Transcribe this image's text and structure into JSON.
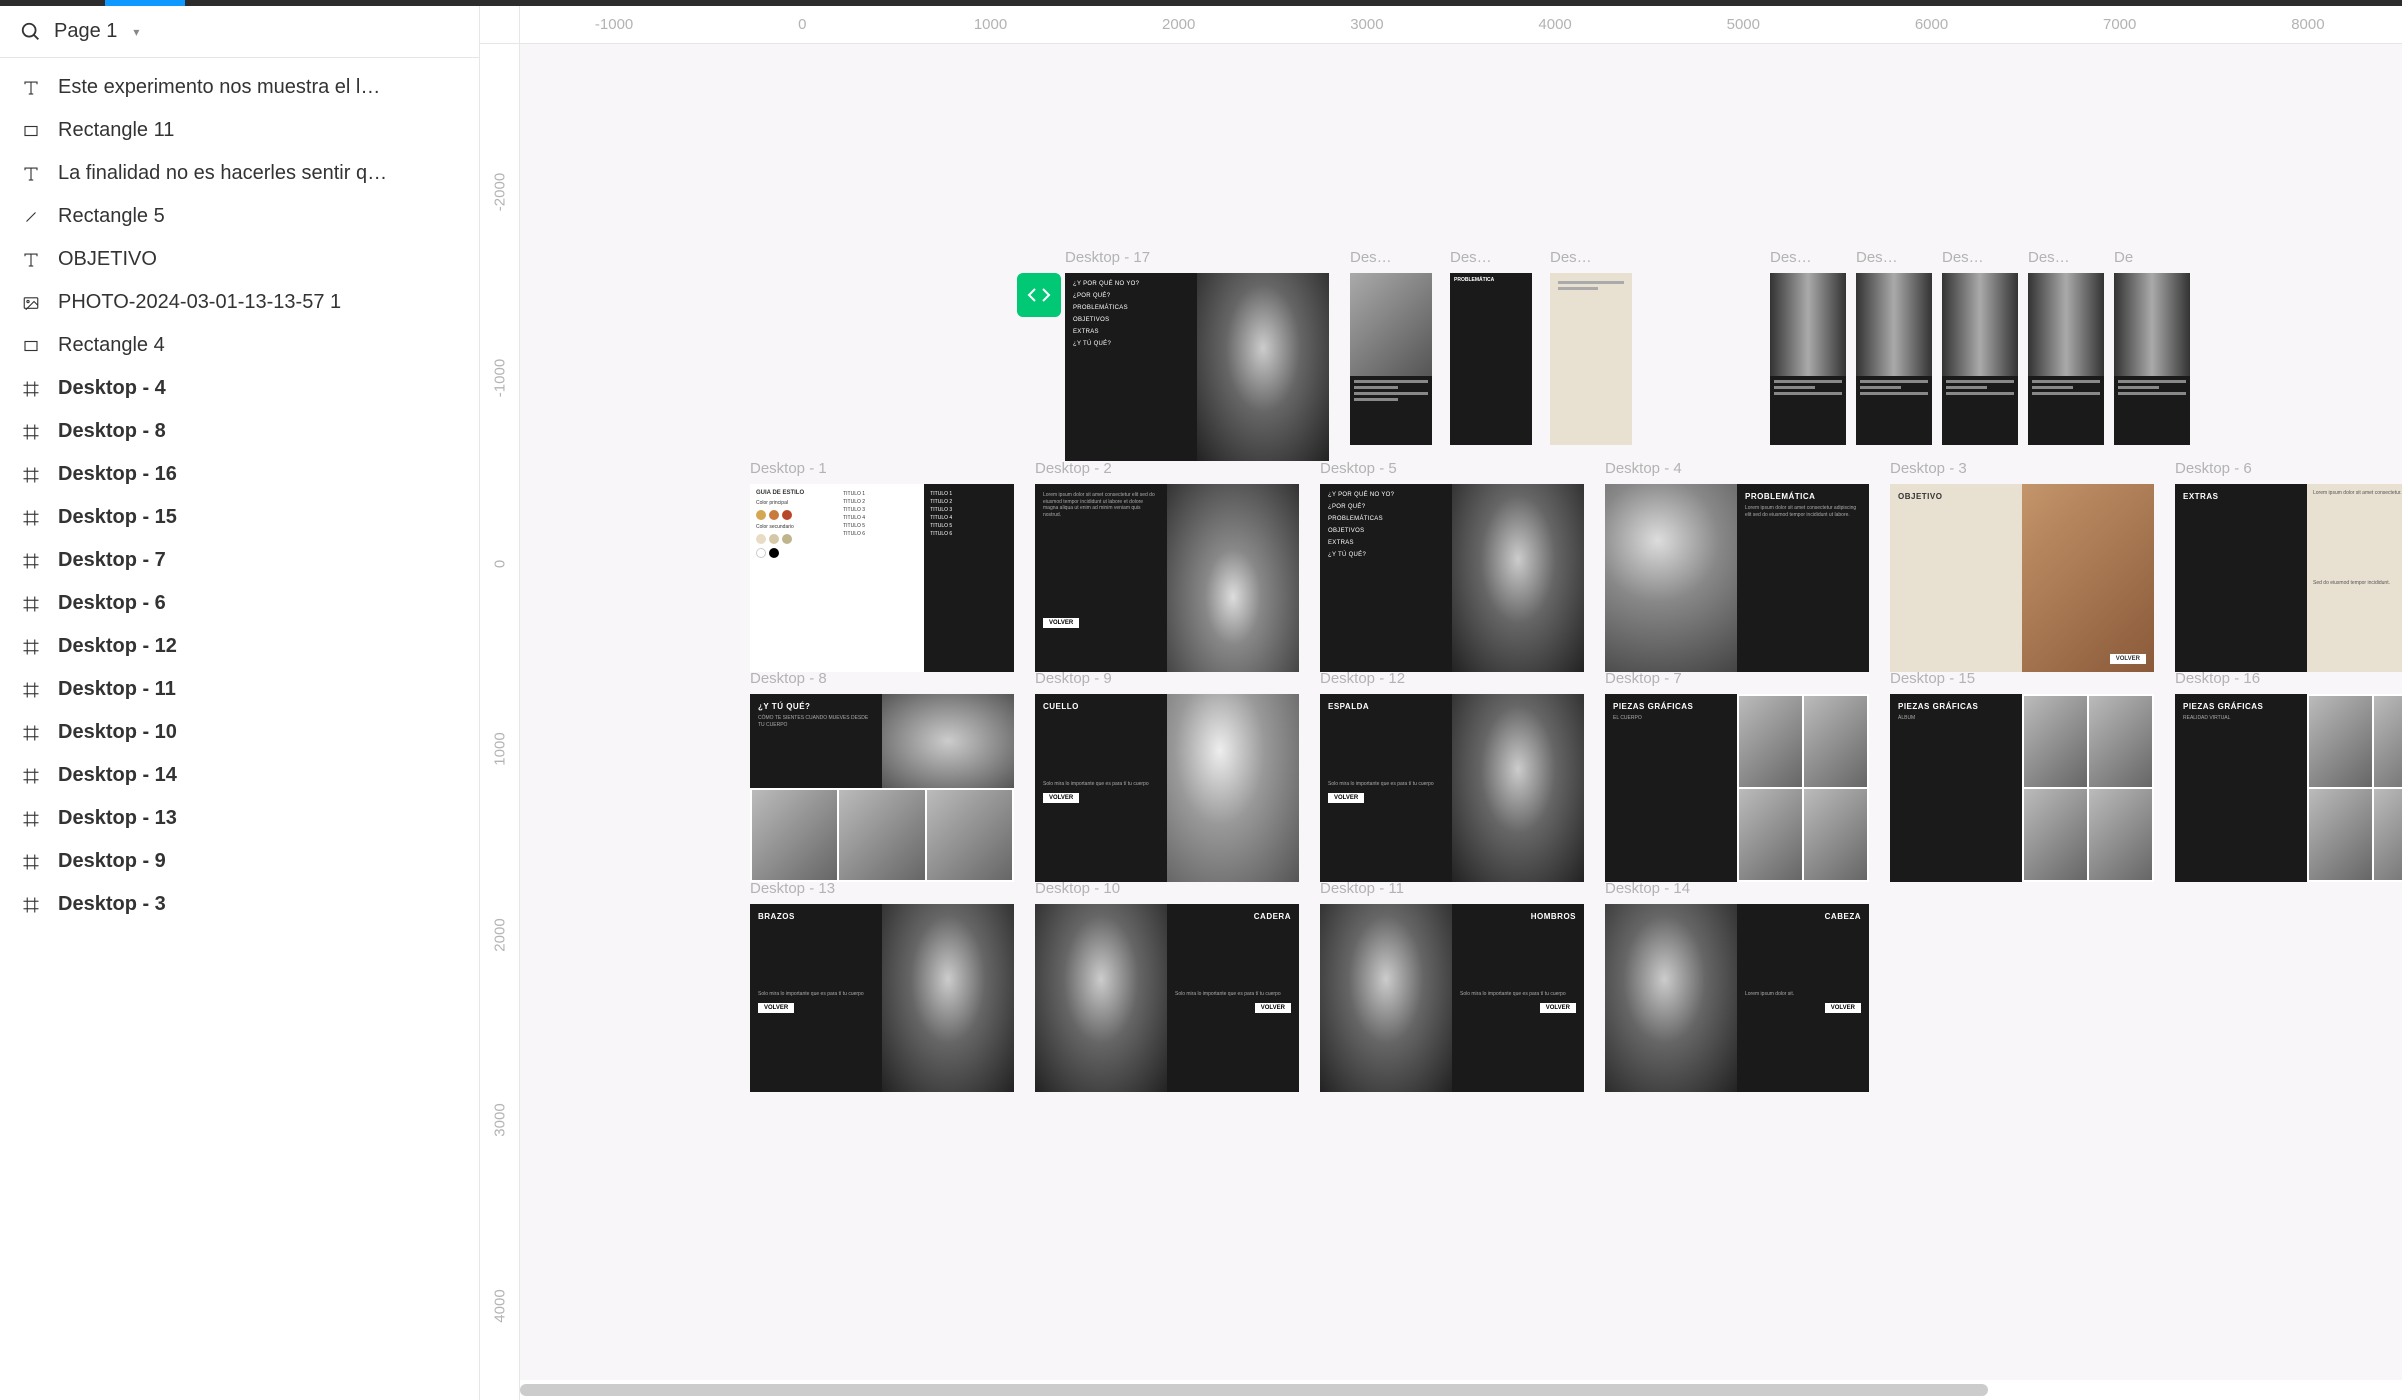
{
  "page": {
    "name": "Page 1"
  },
  "layers": [
    {
      "icon": "text",
      "label": "Este experimento nos muestra el l…",
      "bold": false
    },
    {
      "icon": "rect",
      "label": "Rectangle 11",
      "bold": false
    },
    {
      "icon": "text",
      "label": "La finalidad no es hacerles sentir q…",
      "bold": false
    },
    {
      "icon": "line",
      "label": "Rectangle 5",
      "bold": false
    },
    {
      "icon": "text",
      "label": "OBJETIVO",
      "bold": false
    },
    {
      "icon": "image",
      "label": "PHOTO-2024-03-01-13-13-57 1",
      "bold": false
    },
    {
      "icon": "rect",
      "label": "Rectangle 4",
      "bold": false
    },
    {
      "icon": "frame",
      "label": "Desktop - 4",
      "bold": true
    },
    {
      "icon": "frame",
      "label": "Desktop - 8",
      "bold": true
    },
    {
      "icon": "frame",
      "label": "Desktop - 16",
      "bold": true
    },
    {
      "icon": "frame",
      "label": "Desktop - 15",
      "bold": true
    },
    {
      "icon": "frame",
      "label": "Desktop - 7",
      "bold": true
    },
    {
      "icon": "frame",
      "label": "Desktop - 6",
      "bold": true
    },
    {
      "icon": "frame",
      "label": "Desktop - 12",
      "bold": true
    },
    {
      "icon": "frame",
      "label": "Desktop - 11",
      "bold": true
    },
    {
      "icon": "frame",
      "label": "Desktop - 10",
      "bold": true
    },
    {
      "icon": "frame",
      "label": "Desktop - 14",
      "bold": true
    },
    {
      "icon": "frame",
      "label": "Desktop - 13",
      "bold": true
    },
    {
      "icon": "frame",
      "label": "Desktop - 9",
      "bold": true
    },
    {
      "icon": "frame",
      "label": "Desktop - 3",
      "bold": true
    }
  ],
  "ruler_h": [
    "-1000",
    "0",
    "1000",
    "2000",
    "3000",
    "4000",
    "5000",
    "6000",
    "7000",
    "8000"
  ],
  "ruler_v": [
    "-2000",
    "-1000",
    "0",
    "1000",
    "2000",
    "3000",
    "4000"
  ],
  "frames": {
    "d17": {
      "label": "Desktop - 17",
      "menu": [
        "¿Y POR QUÉ NO YO?",
        "¿POR QUÉ?",
        "PROBLEMÁTICAS",
        "OBJETIVOS",
        "EXTRAS",
        "¿Y TÚ QUÉ?"
      ]
    },
    "top_small": [
      "Des…",
      "Des…",
      "Des…",
      "Des…",
      "Des…",
      "Des…",
      "Des…",
      "De"
    ],
    "top_small_content": [
      "menu",
      "PROBLEMÁTICA",
      "text"
    ],
    "d1": {
      "label": "Desktop - 1",
      "guide": "GUIA DE ESTILO",
      "cp": "Color principal",
      "cs": "Color secundario",
      "titles": [
        "TITULO 1",
        "TITULO 2",
        "TITULO 3",
        "TITULO 4",
        "TITULO 5",
        "TITULO 6"
      ],
      "titles_w": [
        "TITULO 1",
        "TITULO 2",
        "TITULO 3",
        "TITULO 4",
        "TITULO 5",
        "TITULO 6"
      ]
    },
    "d2": {
      "label": "Desktop - 2",
      "btn": "VOLVER"
    },
    "d5": {
      "label": "Desktop - 5",
      "menu": [
        "¿Y POR QUÉ NO YO?",
        "¿POR QUÉ?",
        "PROBLEMÁTICAS",
        "OBJETIVOS",
        "EXTRAS",
        "¿Y TÚ QUÉ?"
      ]
    },
    "d4": {
      "label": "Desktop - 4",
      "title": "PROBLEMÁTICA"
    },
    "d3": {
      "label": "Desktop - 3",
      "title": "OBJETIVO",
      "btn": "VOLVER"
    },
    "d6": {
      "label": "Desktop - 6",
      "title": "EXTRAS"
    },
    "d8": {
      "label": "Desktop - 8",
      "title": "¿Y TÚ QUÉ?",
      "sub": "CÓMO TE SIENTES CUANDO MUEVES DESDE TU CUERPO"
    },
    "d9": {
      "label": "Desktop - 9",
      "title": "CUELLO",
      "note": "Solo mira lo importante que es para tí tu cuerpo",
      "btn": "VOLVER"
    },
    "d12": {
      "label": "Desktop - 12",
      "title": "ESPALDA",
      "note": "Solo mira lo importante que es para tí tu cuerpo",
      "btn": "VOLVER"
    },
    "d7": {
      "label": "Desktop - 7",
      "title": "PIEZAS GRÁFICAS",
      "sub": "EL CUERPO"
    },
    "d15": {
      "label": "Desktop - 15",
      "title": "PIEZAS GRÁFICAS",
      "sub": "ÁLBUM"
    },
    "d16": {
      "label": "Desktop - 16",
      "title": "PIEZAS GRÁFICAS",
      "sub": "REALIDAD VIRTUAL"
    },
    "d13": {
      "label": "Desktop - 13",
      "title": "BRAZOS",
      "note": "Solo mira lo importante que es para tí tu cuerpo",
      "btn": "VOLVER"
    },
    "d10": {
      "label": "Desktop - 10",
      "title": "CADERA",
      "note": "Solo mira lo importante que es para tí tu cuerpo",
      "btn": "VOLVER"
    },
    "d11": {
      "label": "Desktop - 11",
      "title": "HOMBROS",
      "note": "Solo mira lo importante que es para tí tu cuerpo",
      "btn": "VOLVER"
    },
    "d14": {
      "label": "Desktop - 14",
      "title": "CABEZA",
      "btn": "VOLVER"
    }
  }
}
